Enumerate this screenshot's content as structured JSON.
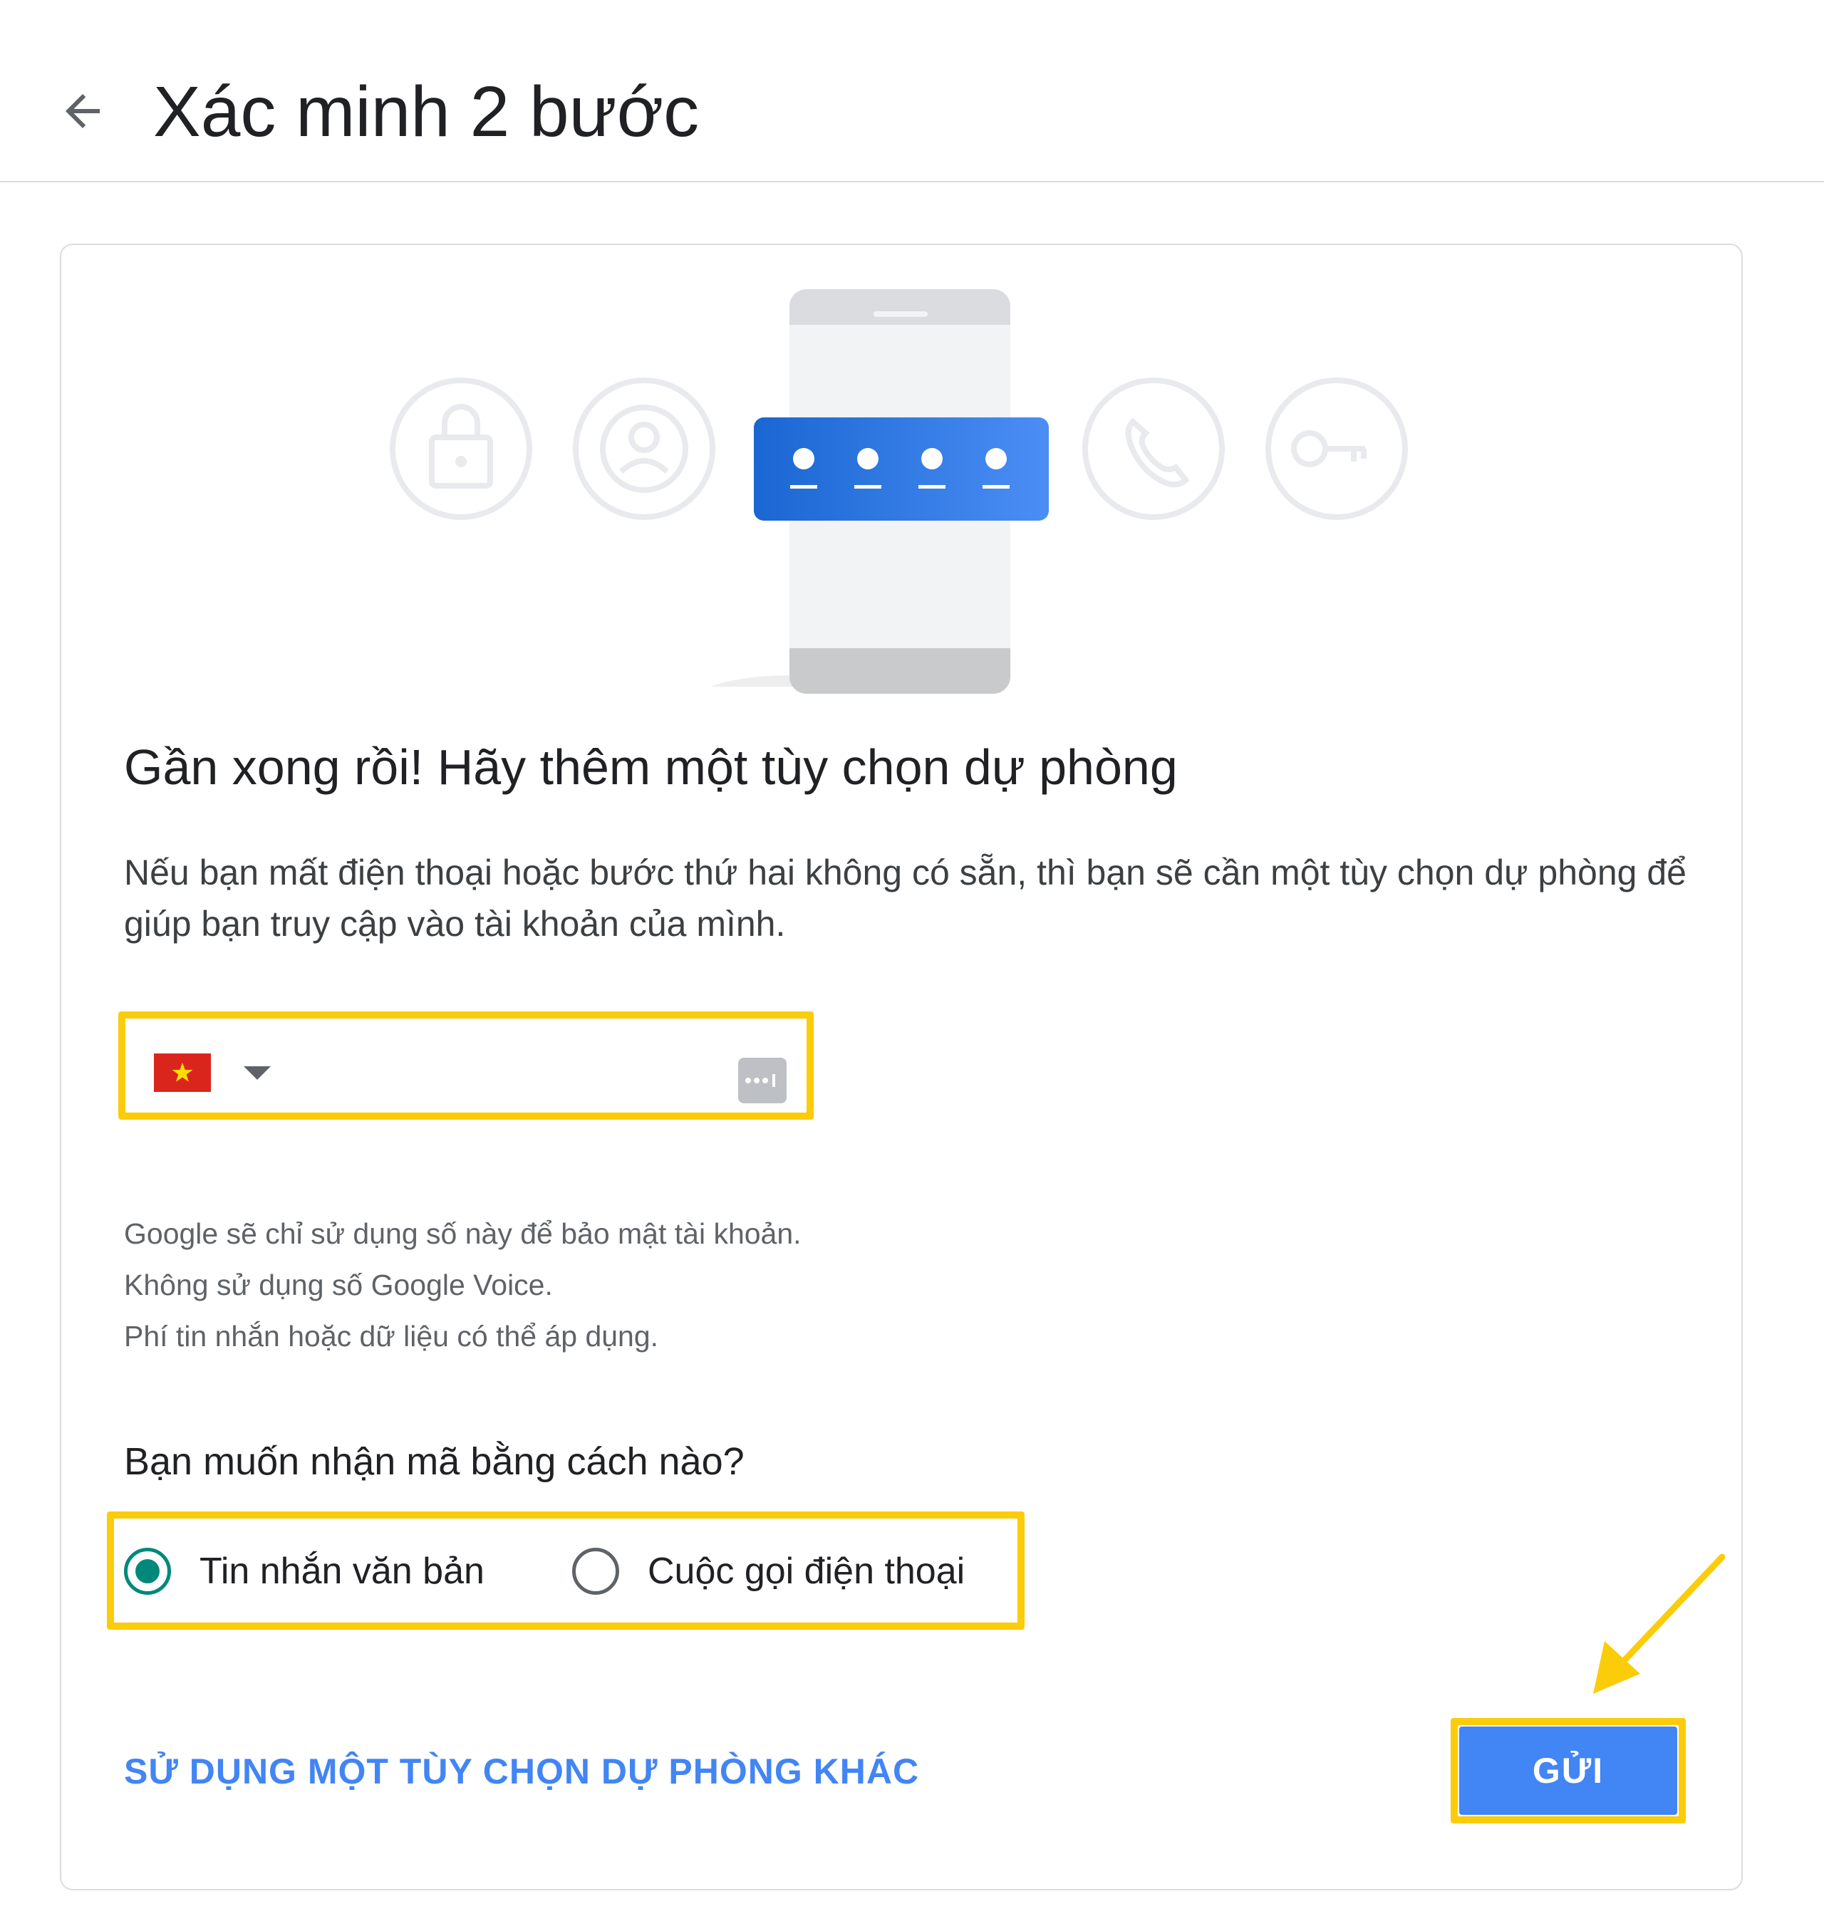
{
  "header": {
    "title": "Xác minh 2 bước"
  },
  "card": {
    "illustration": {
      "code_dots": 4,
      "icons": [
        "lock-icon",
        "account-icon",
        "phone-call-icon",
        "key-icon"
      ]
    },
    "heading": "Gần xong rồi! Hãy thêm một tùy chọn dự phòng",
    "description": "Nếu bạn mất điện thoại hoặc bước thứ hai không có sẵn, thì bạn sẽ cần một tùy chọn dự phòng để giúp bạn truy cập vào tài khoản của mình.",
    "phone_field": {
      "country_flag": "vietnam-flag",
      "value": "",
      "placeholder": ""
    },
    "notes": [
      "Google sẽ chỉ sử dụng số này để bảo mật tài khoản.",
      "Không sử dụng số Google Voice.",
      "Phí tin nhắn hoặc dữ liệu có thể áp dụng."
    ],
    "question": "Bạn muốn nhận mã bằng cách nào?",
    "options": [
      {
        "label": "Tin nhắn văn bản",
        "selected": true
      },
      {
        "label": "Cuộc gọi điện thoại",
        "selected": false
      }
    ],
    "alt_link": "SỬ DỤNG MỘT TÙY CHỌN DỰ PHÒNG KHÁC",
    "send_button": "GỬI"
  },
  "colors": {
    "accent_blue": "#4285f4",
    "radio_teal": "#00897b",
    "highlight_yellow": "#fbcc0a",
    "flag_red": "#da251d",
    "flag_star": "#ffde00"
  }
}
